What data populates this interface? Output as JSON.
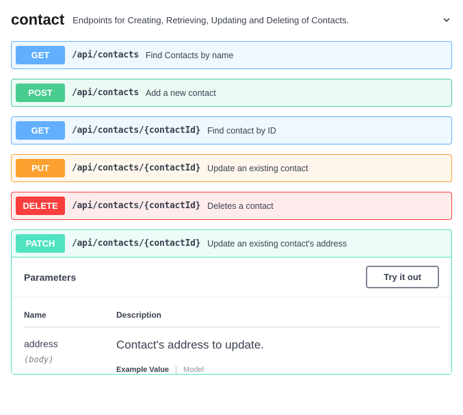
{
  "tag": {
    "name": "contact",
    "description": "Endpoints for Creating, Retrieving, Updating and Deleting of Contacts."
  },
  "endpoints": [
    {
      "method": "GET",
      "css": "get",
      "path": "/api/contacts",
      "summary": "Find Contacts by name"
    },
    {
      "method": "POST",
      "css": "post",
      "path": "/api/contacts",
      "summary": "Add a new contact"
    },
    {
      "method": "GET",
      "css": "get",
      "path": "/api/contacts/{contactId}",
      "summary": "Find contact by ID"
    },
    {
      "method": "PUT",
      "css": "put",
      "path": "/api/contacts/{contactId}",
      "summary": "Update an existing contact"
    },
    {
      "method": "DELETE",
      "css": "delete",
      "path": "/api/contacts/{contactId}",
      "summary": "Deletes a contact"
    }
  ],
  "expanded": {
    "method": "PATCH",
    "css": "patch",
    "path": "/api/contacts/{contactId}",
    "summary": "Update an existing contact's address",
    "parameters_label": "Parameters",
    "tryit_label": "Try it out",
    "columns": {
      "name": "Name",
      "desc": "Description"
    },
    "param": {
      "name": "address",
      "location": "(body)",
      "description": "Contact's address to update."
    },
    "tabs": {
      "active": "Example Value",
      "inactive": "Model"
    }
  }
}
